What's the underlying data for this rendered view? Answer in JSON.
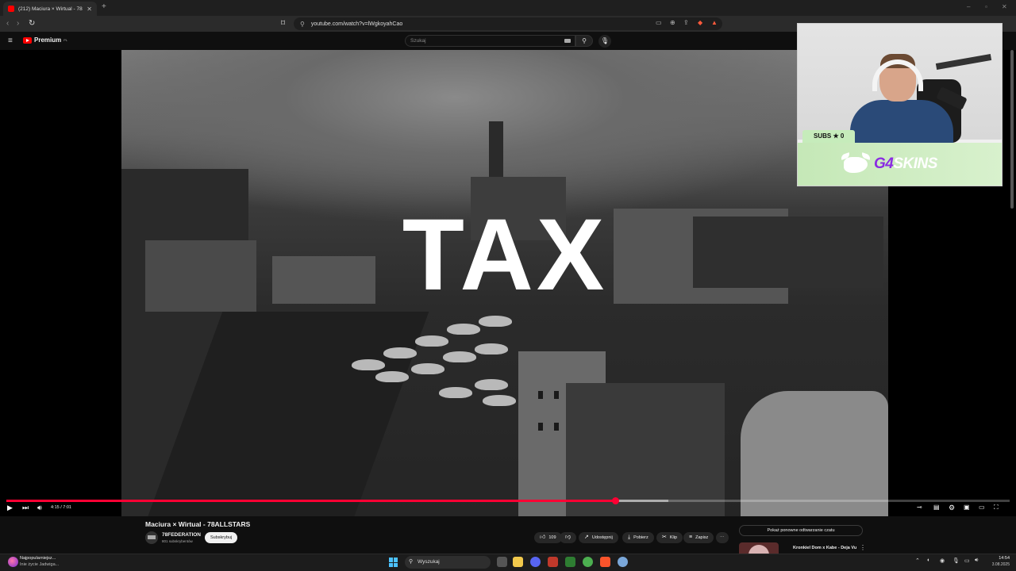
{
  "browser": {
    "tab_title": "(212) Maciura × Wirtual - 78ALLSTARS",
    "url": "youtube.com/watch?v=lWgkoyahCao"
  },
  "youtube": {
    "premium_label": "Premium",
    "premium_region": "PL",
    "search_placeholder": "Szukaj"
  },
  "video": {
    "overlay_text": "TAX",
    "time_display": "4:15 / 7:01",
    "progress_fraction": 0.607,
    "buffered_fraction": 0.66
  },
  "stream_overlay": {
    "subs_label": "SUBS ★ 0",
    "brand_prefix": "G4",
    "brand_name": "SKINS"
  },
  "below_video": {
    "title": "Maciura × Wirtual - 78ALLSTARS",
    "channel_name": "78FEDERATION",
    "channel_subs": "801 subskrybentów",
    "subscribe_label": "Subskrybuj",
    "like_count": "109",
    "share_label": "Udostępnij",
    "download_label": "Pobierz",
    "clip_label": "Klip",
    "save_label": "Zapisz",
    "live_chat_label": "Pokaż ponowne odtwarzanie czatu",
    "reco_title": "Kronkiel Dom x Kabe - Deja Vu"
  },
  "taskbar": {
    "weather_line1": "Najpopularniejsz...",
    "weather_line2": "Inie życie Jadwiga...",
    "search_label": "Wyszukaj",
    "time": "14:54",
    "date": "3.08.2025"
  },
  "colors": {
    "accent_red": "#ff0033",
    "brand_green": "#c5e8b7",
    "youtube_bg": "#0f0f0f"
  }
}
